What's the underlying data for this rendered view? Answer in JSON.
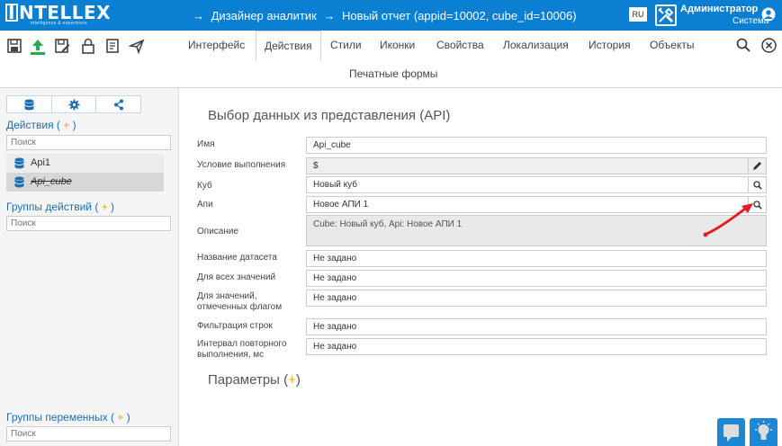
{
  "header": {
    "logo_text": "NTELLEX",
    "logo_initial": "I",
    "logo_tagline": "intelligence & experience",
    "breadcrumbs": [
      "→",
      "Дизайнер аналитик",
      "→",
      "Новый отчет (appid=10002, cube_id=10006)"
    ],
    "language": "RU",
    "user_name": "Администратор",
    "user_role": "Система"
  },
  "toolbar": {
    "tabs": [
      "Интерфейс",
      "Действия",
      "Стили",
      "Иконки",
      "Свойства",
      "Локализация",
      "История",
      "Объекты"
    ],
    "active_tab": "Действия",
    "subtab": "Печатные формы"
  },
  "sidebar": {
    "actions_title": "Действия",
    "plus": "+",
    "actions_search_placeholder": "Поиск",
    "items": [
      {
        "label": "Api1"
      },
      {
        "label": "Api_cube"
      }
    ],
    "action_groups_title": "Группы действий",
    "action_groups_search_placeholder": "Поиск",
    "var_groups_title": "Группы переменных",
    "var_groups_search_placeholder": "Поиск"
  },
  "form": {
    "title": "Выбор данных из представления (API)",
    "rows": [
      {
        "label": "Имя",
        "value": "Api_cube"
      },
      {
        "label": "Условие выполнения",
        "value": "$"
      },
      {
        "label": "Куб",
        "value": "Новый куб"
      },
      {
        "label": "Апи",
        "value": "Новое АПИ 1"
      },
      {
        "label": "Описание",
        "value": "Cube: Новый куб, Api: Новое АПИ 1"
      },
      {
        "label": "Название датасета",
        "value": "Не задано"
      },
      {
        "label": "Для всех значений",
        "value": "Не задано"
      },
      {
        "label_line1": "Для значений,",
        "label_line2": "отмеченных флагом",
        "value": "Не задано"
      },
      {
        "label": "Фильтрация строк",
        "value": "Не задано"
      },
      {
        "label_line1": "Интервал повторного",
        "label_line2": "выполнения, мс",
        "value": "Не задано"
      }
    ],
    "params_title": "Параметры",
    "params_plus": "+"
  },
  "colors": {
    "header_bg": "#0b7fd2",
    "accent_plus": "#f0a500",
    "link_blue": "#1a6fb5",
    "annotation_arrow": "#e02020"
  },
  "icons": {
    "toolbar": [
      "save-icon",
      "upload-icon",
      "save-as-icon",
      "lock-icon",
      "document-icon",
      "send-icon"
    ],
    "sidebar_tabs": [
      "database-icon",
      "gear-icon",
      "share-icon"
    ]
  }
}
